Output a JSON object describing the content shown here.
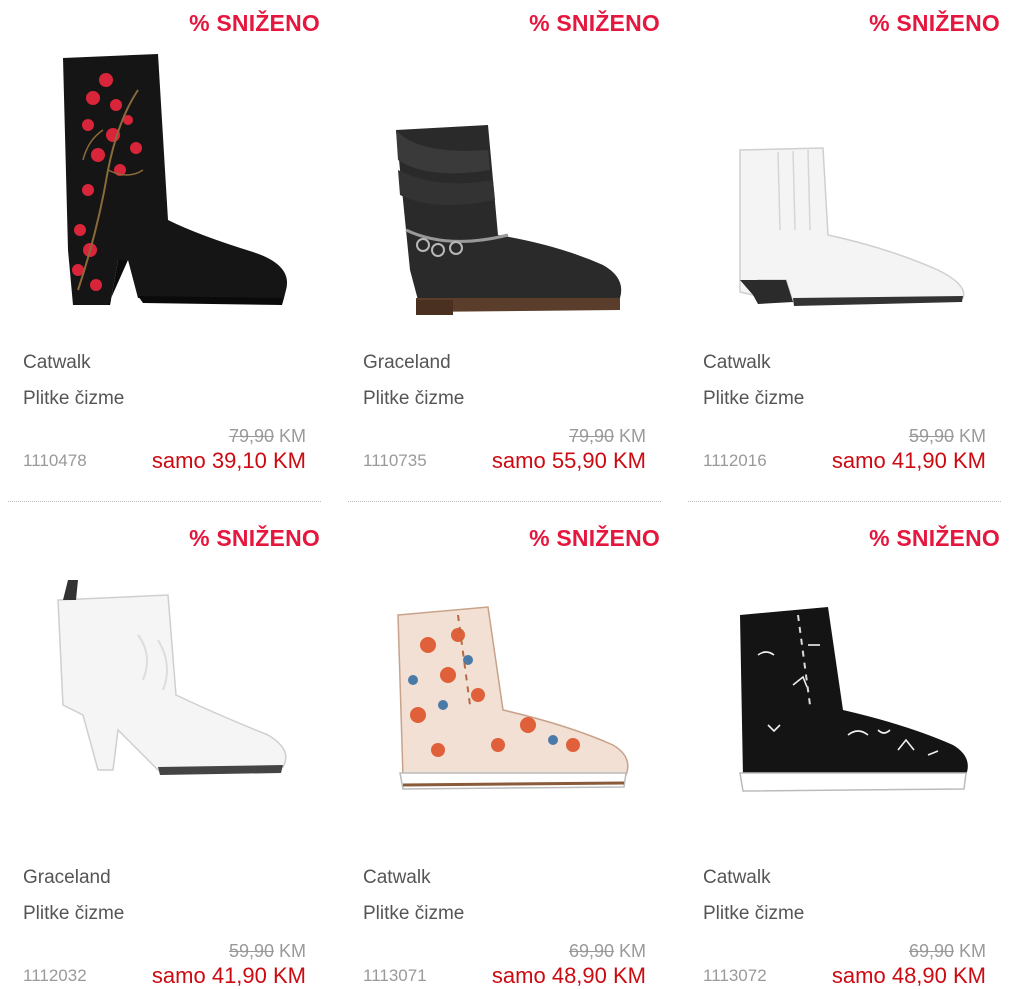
{
  "products": [
    {
      "badge": "% SNIŽENO",
      "brand": "Catwalk",
      "type": "Plitke čizme",
      "code": "1110478",
      "old_price": "79,90",
      "currency": "KM",
      "new_price": "samo 39,10 KM",
      "image": "black-floral-ankle-boot"
    },
    {
      "badge": "% SNIŽENO",
      "brand": "Graceland",
      "type": "Plitke čizme",
      "code": "1110735",
      "old_price": "79,90",
      "currency": "KM",
      "new_price": "samo 55,90 KM",
      "image": "black-slouch-boot-with-chains"
    },
    {
      "badge": "% SNIŽENO",
      "brand": "Catwalk",
      "type": "Plitke čizme",
      "code": "1112016",
      "old_price": "59,90",
      "currency": "KM",
      "new_price": "samo 41,90 KM",
      "image": "white-western-boot"
    },
    {
      "badge": "% SNIŽENO",
      "brand": "Graceland",
      "type": "Plitke čizme",
      "code": "1112032",
      "old_price": "59,90",
      "currency": "KM",
      "new_price": "samo 41,90 KM",
      "image": "white-heeled-ankle-boot"
    },
    {
      "badge": "% SNIŽENO",
      "brand": "Catwalk",
      "type": "Plitke čizme",
      "code": "1113071",
      "old_price": "69,90",
      "currency": "KM",
      "new_price": "samo 48,90 KM",
      "image": "floral-lace-up-boot"
    },
    {
      "badge": "% SNIŽENO",
      "brand": "Catwalk",
      "type": "Plitke čizme",
      "code": "1113072",
      "old_price": "69,90",
      "currency": "KM",
      "new_price": "samo 48,90 KM",
      "image": "black-graffiti-lace-up-boot"
    }
  ],
  "colors": {
    "badge": "#e5173f",
    "sale_price": "#cc0a12",
    "text": "#555555",
    "muted": "#9a9a9a"
  }
}
